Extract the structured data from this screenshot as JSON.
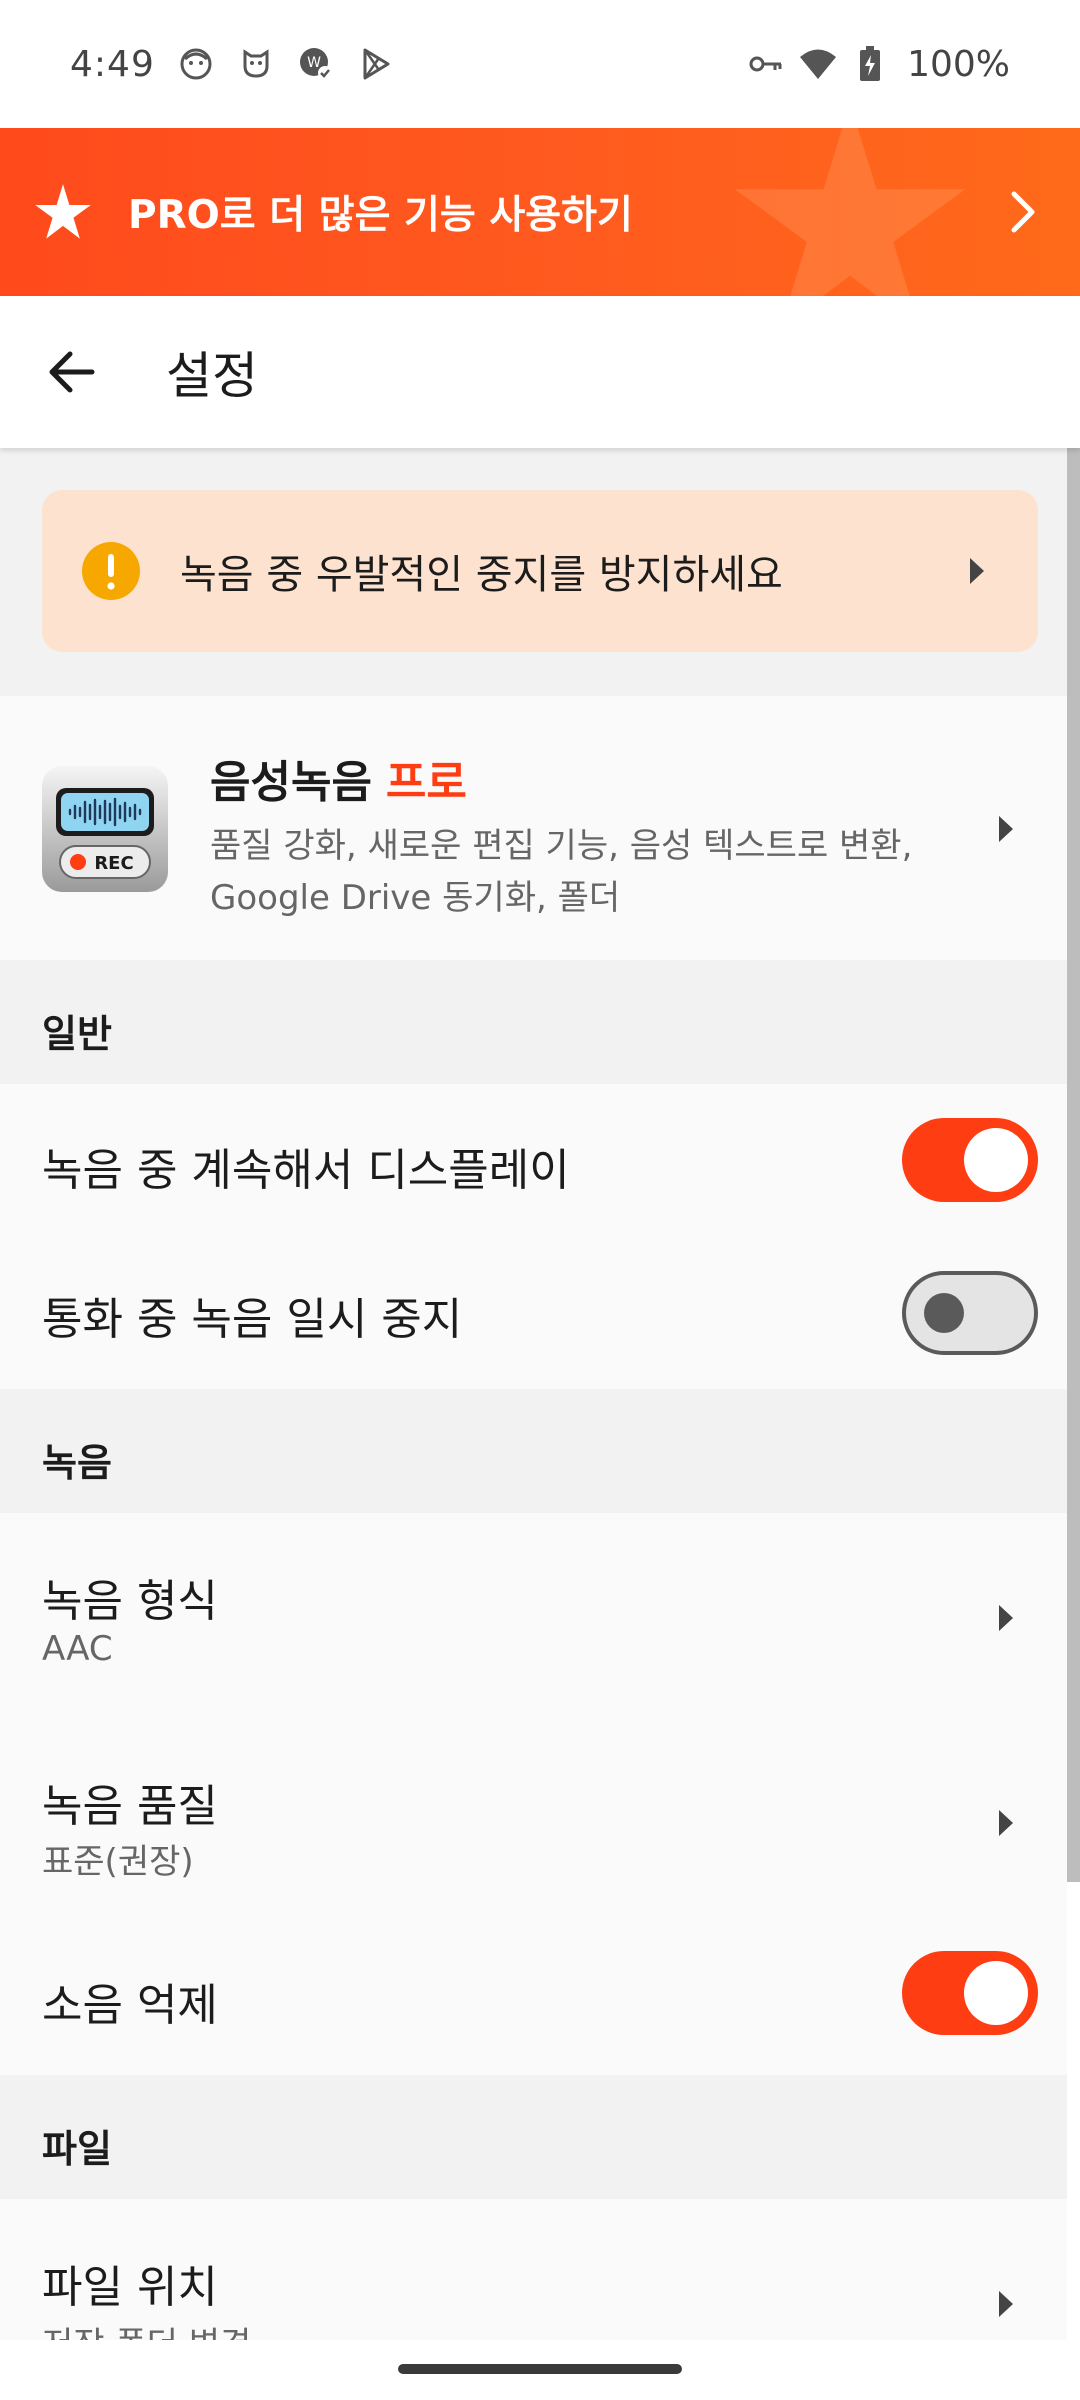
{
  "status_bar": {
    "time": "4:49",
    "battery": "100%",
    "left_icons": [
      "face-icon",
      "mask-icon",
      "bubble-check-icon",
      "play-store-icon"
    ],
    "right_icons": [
      "key-icon",
      "wifi-icon",
      "battery-charging-icon"
    ]
  },
  "promo": {
    "text": "PRO로 더 많은 기능 사용하기",
    "icon": "star-icon",
    "color": "#ff4a1c"
  },
  "app_bar": {
    "title": "설정"
  },
  "warning": {
    "text": "녹음 중 우발적인 중지를 방지하세요",
    "icon": "exclamation-icon",
    "icon_color": "#f6a800",
    "background": "#fde3cf"
  },
  "pro_card": {
    "title": "음성녹음",
    "title_accent": "프로",
    "description": "품질 강화, 새로운 편집 기능, 음성 텍스트로 변환, Google Drive 동기화, 폴더",
    "icon_label": "REC"
  },
  "sections": {
    "general": "일반",
    "recording": "녹음",
    "files": "파일"
  },
  "settings": {
    "keep_display": {
      "title": "녹음 중 계속해서 디스플레이",
      "enabled": true
    },
    "pause_on_call": {
      "title": "통화 중 녹음 일시 중지",
      "enabled": false
    },
    "format": {
      "title": "녹음 형식",
      "value": "AAC"
    },
    "quality": {
      "title": "녹음 품질",
      "value": "표준(권장)"
    },
    "noise": {
      "title": "소음 억제",
      "enabled": true
    },
    "file_location": {
      "title": "파일 위치",
      "value": "저장 폴더 변경"
    }
  },
  "accent_color": "#ff3d12"
}
